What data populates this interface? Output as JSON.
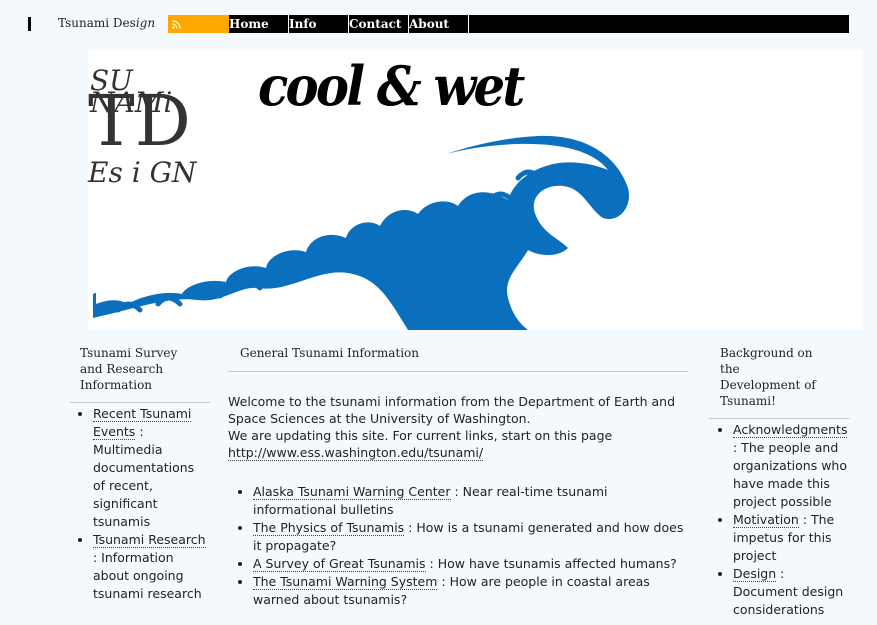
{
  "header": {
    "site_title_plain": "Tsunami Des",
    "site_title_italic": "ign",
    "rss_icon": "rss-feed-icon"
  },
  "nav": {
    "items": [
      {
        "label": "Home"
      },
      {
        "label": "Info"
      },
      {
        "label": "Contact"
      },
      {
        "label": "About"
      }
    ]
  },
  "banner": {
    "logo": {
      "su": "SU",
      "nami": "NAMi",
      "td": "TD",
      "es": "Es i GN"
    },
    "tagline": "cool & wet",
    "wave_color": "#0a6fbd"
  },
  "left": {
    "heading": "Tsunami Survey and Research Information",
    "items": [
      {
        "link": "Recent Tsunami Events",
        "desc": ": Multimedia documentations of recent, significant tsunamis"
      },
      {
        "link": "Tsunami Research",
        "desc": ": Information about ongoing tsunami research"
      }
    ]
  },
  "main": {
    "heading": "General Tsunami Information",
    "intro1": "Welcome to the tsunami information from the Department of Earth and Space Sciences at the University of Washington.",
    "intro2": "We are updating this site. For current links, start on this page",
    "intro_link": "http://www.ess.washington.edu/tsunami/",
    "items": [
      {
        "link": "Alaska Tsunami Warning Center",
        "desc": ": Near real-time tsunami informational bulletins"
      },
      {
        "link": "The Physics of Tsunamis",
        "desc": ": How is a tsunami generated and how does it propagate?"
      },
      {
        "link": "A Survey of Great Tsunamis",
        "desc": ": How have tsunamis affected humans?"
      },
      {
        "link": "The Tsunami Warning System",
        "desc": ": How are people in coastal areas warned about tsunamis?"
      }
    ]
  },
  "right": {
    "heading": "Background on the Development of Tsunami!",
    "items": [
      {
        "link": "Acknowledgments",
        "desc": ": The people and organizations who have made this project possible"
      },
      {
        "link": "Motivation",
        "desc": ": The impetus for this project"
      },
      {
        "link": "Design",
        "desc": ": Document design considerations"
      }
    ]
  }
}
